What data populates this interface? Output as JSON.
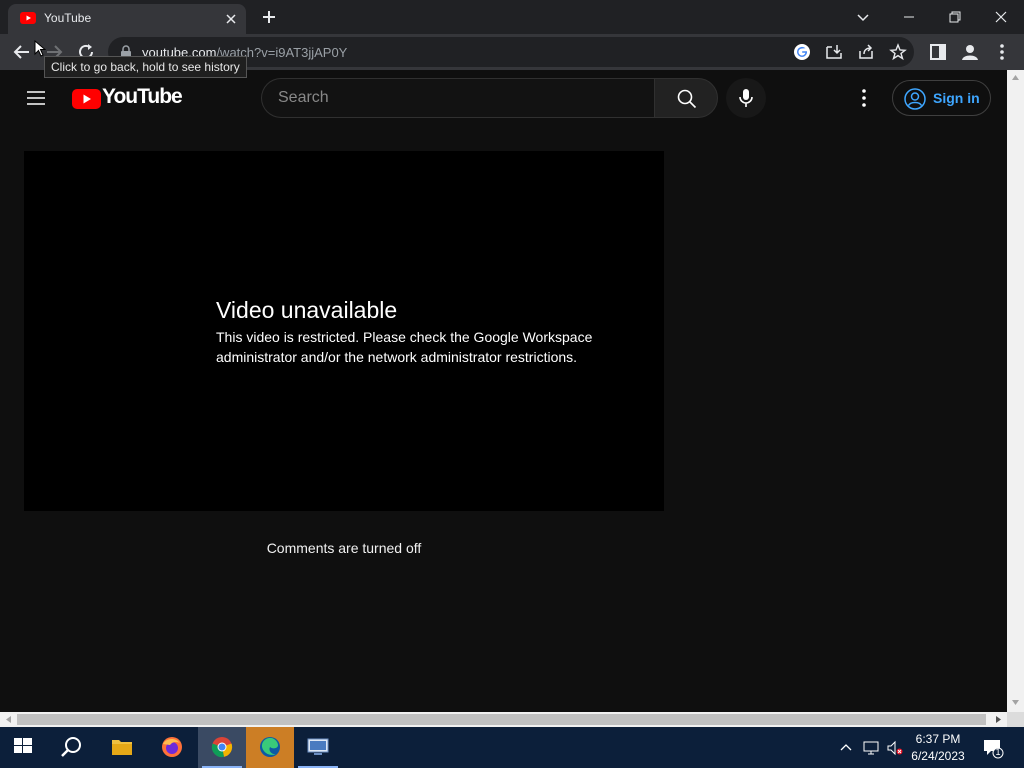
{
  "browser": {
    "tab_title": "YouTube",
    "url_host": "youtube.com",
    "url_path": "/watch?v=i9AT3jjAP0Y",
    "back_tooltip": "Click to go back, hold to see history"
  },
  "youtube": {
    "logo_text": "YouTube",
    "search_placeholder": "Search",
    "signin_label": "Sign in",
    "error_title": "Video unavailable",
    "error_message": "This video is restricted. Please check the Google Workspace administrator and/or the network administrator restrictions.",
    "comments_status": "Comments are turned off"
  },
  "taskbar": {
    "time": "6:37 PM",
    "date": "6/24/2023",
    "notification_count": "1"
  },
  "colors": {
    "yt_red": "#ff0000",
    "signin_blue": "#3ea6ff",
    "page_bg": "#0f0f0f"
  },
  "icons": [
    "youtube-favicon",
    "close-icon",
    "plus-icon",
    "chevron-down-icon",
    "minimize-icon",
    "restore-icon",
    "back-icon",
    "forward-icon",
    "reload-icon",
    "lock-icon",
    "google-icon",
    "install-icon",
    "share-icon",
    "star-icon",
    "side-panel-icon",
    "profile-icon",
    "kebab-icon",
    "hamburger-icon",
    "search-icon",
    "mic-icon",
    "user-circle-icon",
    "windows-icon",
    "file-explorer-icon",
    "firefox-icon",
    "chrome-icon",
    "edge-icon",
    "network-icon",
    "volume-muted-icon",
    "notification-icon"
  ]
}
